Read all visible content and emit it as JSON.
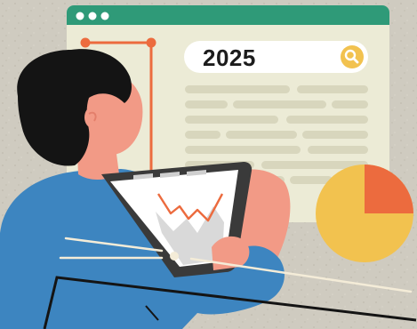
{
  "search": {
    "query": "2025",
    "icon": "search-icon"
  },
  "window": {
    "title_bar_color": "#2f9a78",
    "controls": [
      "window-dot-icon",
      "window-dot-icon",
      "window-dot-icon"
    ]
  },
  "palette": {
    "background": "#cfcbc0",
    "panel": "#ecebd6",
    "text_line": "#d8d6bd",
    "accent_orange": "#ec6b3e",
    "accent_yellow": "#f2c24f",
    "person_shirt": "#3d85c0",
    "person_hair": "#141414",
    "person_skin": "#f29a86"
  },
  "illustration": {
    "subject": "person-with-tablet",
    "pie_chart_slice_fraction": 0.25
  }
}
